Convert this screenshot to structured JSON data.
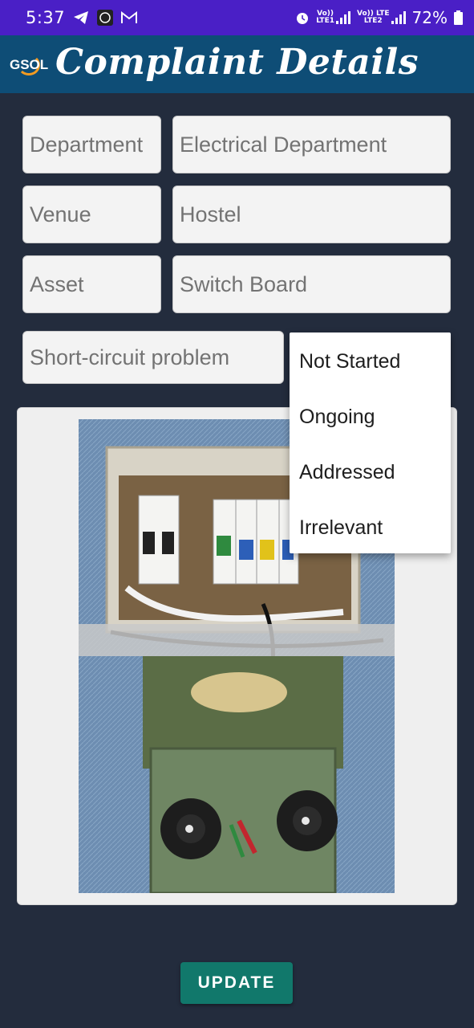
{
  "status_bar": {
    "time": "5:37",
    "left_icons": [
      "telegram-icon",
      "app-icon",
      "gmail-icon"
    ],
    "network_1_top": "Vo))",
    "network_1_bottom": "LTE1",
    "network_2_top": "Vo)) LTE",
    "network_2_bottom": "LTE2",
    "battery": "72%"
  },
  "app_bar": {
    "logo_text": "GSOL",
    "title": "Complaint Details"
  },
  "form": {
    "department_label": "Department",
    "department_value": "Electrical Department",
    "venue_label": "Venue",
    "venue_value": "Hostel",
    "asset_label": "Asset",
    "asset_value": "Switch Board",
    "description": "Short-circuit problem"
  },
  "status_dropdown": {
    "options": [
      "Not Started",
      "Ongoing",
      "Addressed",
      "Irrelevant"
    ]
  },
  "image": {
    "icon": "complaint-photo"
  },
  "update_button": "UPDATE",
  "colors": {
    "status_bar": "#4a1fc6",
    "app_bar": "#0e4d76",
    "background": "#232c3d",
    "button": "#11786b"
  }
}
